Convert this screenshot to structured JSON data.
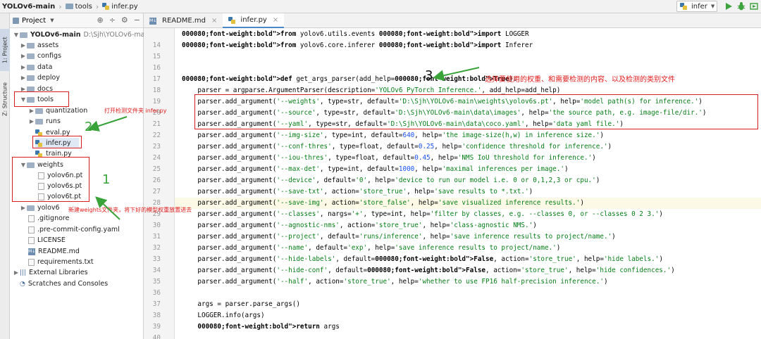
{
  "navbar": {
    "project": "YOLOv6-main",
    "folder": "tools",
    "file": "infer.py",
    "run_config": "infer"
  },
  "toolstrip": {
    "project_tab": "1: Project",
    "structure_tab": "Z: Structure"
  },
  "project_panel": {
    "title": "Project",
    "root_name": "YOLOv6-main",
    "root_path": "D:\\Sjh\\YOLOv6-main",
    "items": [
      {
        "label": "assets",
        "kind": "folder"
      },
      {
        "label": "configs",
        "kind": "folder"
      },
      {
        "label": "data",
        "kind": "folder"
      },
      {
        "label": "deploy",
        "kind": "folder"
      },
      {
        "label": "docs",
        "kind": "folder"
      },
      {
        "label": "tools",
        "kind": "folder"
      },
      {
        "label": "quantization",
        "kind": "folder"
      },
      {
        "label": "runs",
        "kind": "folder"
      },
      {
        "label": "eval.py",
        "kind": "py"
      },
      {
        "label": "infer.py",
        "kind": "py"
      },
      {
        "label": "train.py",
        "kind": "py"
      },
      {
        "label": "weights",
        "kind": "folder"
      },
      {
        "label": "yolov6n.pt",
        "kind": "file"
      },
      {
        "label": "yolov6s.pt",
        "kind": "file"
      },
      {
        "label": "yolov6t.pt",
        "kind": "file"
      },
      {
        "label": "yolov6",
        "kind": "folder"
      },
      {
        "label": ".gitignore",
        "kind": "file"
      },
      {
        "label": ".pre-commit-config.yaml",
        "kind": "file"
      },
      {
        "label": "LICENSE",
        "kind": "file"
      },
      {
        "label": "README.md",
        "kind": "md"
      },
      {
        "label": "requirements.txt",
        "kind": "file"
      },
      {
        "label": "External Libraries",
        "kind": "lib"
      },
      {
        "label": "Scratches and Consoles",
        "kind": "scratch"
      }
    ]
  },
  "editor": {
    "tabs": [
      {
        "label": "README.md"
      },
      {
        "label": "infer.py"
      }
    ],
    "lines": [
      {
        "n": "",
        "text": "from yolov6.utils.events import LOGGER"
      },
      {
        "n": "14",
        "text": "from yolov6.core.inferer import Inferer"
      },
      {
        "n": "15",
        "text": ""
      },
      {
        "n": "16",
        "text": ""
      },
      {
        "n": "17",
        "text": "def get_args_parser(add_help=True):"
      },
      {
        "n": "18",
        "text": "    parser = argparse.ArgumentParser(description='YOLOv6 PyTorch Inference.', add_help=add_help)"
      },
      {
        "n": "19",
        "text": "    parser.add_argument('--weights', type=str, default='D:\\Sjh\\YOLOv6-main\\weights\\yolov6s.pt', help='model path(s) for inference.')"
      },
      {
        "n": "20",
        "text": "    parser.add_argument('--source', type=str, default='D:\\Sjh\\YOLOv6-main\\data\\images', help='the source path, e.g. image-file/dir.')"
      },
      {
        "n": "21",
        "text": "    parser.add_argument('--yaml', type=str, default='D:\\Sjh\\YOLOv6-main\\data\\coco.yaml', help='data yaml file.')"
      },
      {
        "n": "22",
        "text": "    parser.add_argument('--img-size', type=int, default=640, help='the image-size(h,w) in inference size.')"
      },
      {
        "n": "23",
        "text": "    parser.add_argument('--conf-thres', type=float, default=0.25, help='confidence threshold for inference.')"
      },
      {
        "n": "24",
        "text": "    parser.add_argument('--iou-thres', type=float, default=0.45, help='NMS IoU threshold for inference.')"
      },
      {
        "n": "25",
        "text": "    parser.add_argument('--max-det', type=int, default=1000, help='maximal inferences per image.')"
      },
      {
        "n": "26",
        "text": "    parser.add_argument('--device', default='0', help='device to run our model i.e. 0 or 0,1,2,3 or cpu.')"
      },
      {
        "n": "27",
        "text": "    parser.add_argument('--save-txt', action='store_true', help='save results to *.txt.')"
      },
      {
        "n": "28",
        "text": "    parser.add_argument('--save-img', action='store_false', help='save visualized inference results.')"
      },
      {
        "n": "29",
        "text": "    parser.add_argument('--classes', nargs='+', type=int, help='filter by classes, e.g. --classes 0, or --classes 0 2 3.')"
      },
      {
        "n": "30",
        "text": "    parser.add_argument('--agnostic-nms', action='store_true', help='class-agnostic NMS.')"
      },
      {
        "n": "31",
        "text": "    parser.add_argument('--project', default='runs/inference', help='save inference results to project/name.')"
      },
      {
        "n": "32",
        "text": "    parser.add_argument('--name', default='exp', help='save inference results to project/name.')"
      },
      {
        "n": "33",
        "text": "    parser.add_argument('--hide-labels', default=False, action='store_true', help='hide labels.')"
      },
      {
        "n": "34",
        "text": "    parser.add_argument('--hide-conf', default=False, action='store_true', help='hide confidences.')"
      },
      {
        "n": "35",
        "text": "    parser.add_argument('--half', action='store_true', help='whether to use FP16 half-precision inference.')"
      },
      {
        "n": "36",
        "text": ""
      },
      {
        "n": "37",
        "text": "    args = parser.parse_args()"
      },
      {
        "n": "38",
        "text": "    LOGGER.info(args)"
      },
      {
        "n": "39",
        "text": "    return args"
      },
      {
        "n": "40",
        "text": ""
      }
    ]
  },
  "annotations": {
    "step1_number": "1",
    "step1_text": "新建weights文件夹，将下好的模型权重放置进去",
    "step2_number": "2",
    "step2_text": "打开检测文件夹 infer.py",
    "step3_number": "3",
    "step3_text": "选择要使用的权重、和需要检测的内容、以及检测的类别文件"
  },
  "colors": {
    "annotation_red": "#e01b1b",
    "arrow_green": "#39a33a",
    "keyword_blue": "#000080",
    "string_green": "#067d17"
  }
}
